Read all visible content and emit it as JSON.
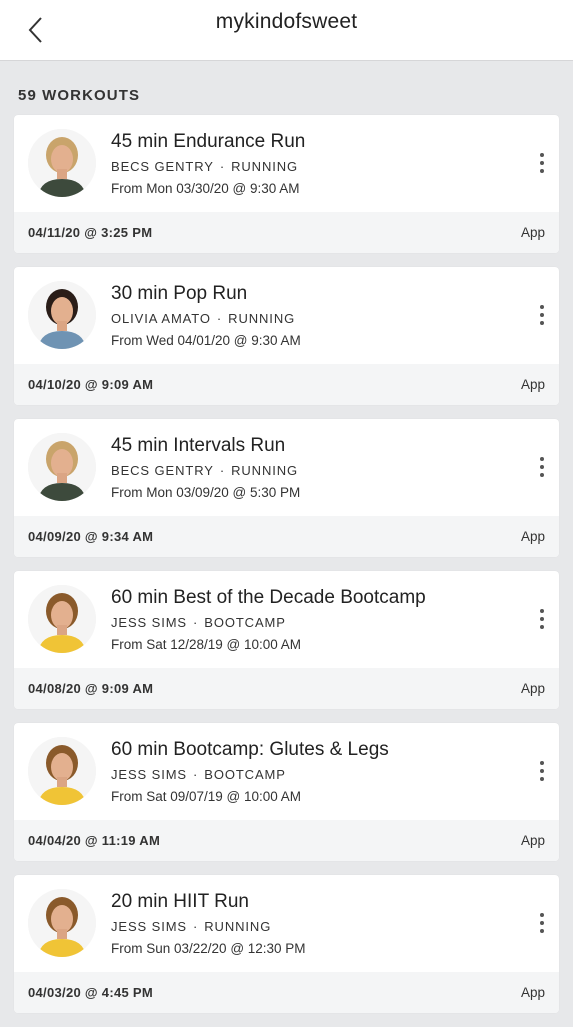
{
  "header": {
    "title": "mykindofsweet",
    "back_icon": "chevron-left-icon"
  },
  "workouts_count": "59 WORKOUTS",
  "workouts": [
    {
      "title": "45 min Endurance Run",
      "instructor": "BECS GENTRY",
      "category": "RUNNING",
      "scheduled": "From Mon 03/30/20 @ 9:30 AM",
      "completed": "04/11/20 @ 3:25 PM",
      "source": "App",
      "avatar": "instructor-becs-gentry-avatar",
      "avatar_hair": "#c9a46b",
      "avatar_top": "#3d4a3c"
    },
    {
      "title": "30 min Pop Run",
      "instructor": "OLIVIA AMATO",
      "category": "RUNNING",
      "scheduled": "From Wed 04/01/20 @ 9:30 AM",
      "completed": "04/10/20 @ 9:09 AM",
      "source": "App",
      "avatar": "instructor-olivia-amato-avatar",
      "avatar_hair": "#2a1d18",
      "avatar_top": "#6f93b3"
    },
    {
      "title": "45 min Intervals Run",
      "instructor": "BECS GENTRY",
      "category": "RUNNING",
      "scheduled": "From Mon 03/09/20 @ 5:30 PM",
      "completed": "04/09/20 @ 9:34 AM",
      "source": "App",
      "avatar": "instructor-becs-gentry-avatar",
      "avatar_hair": "#c9a46b",
      "avatar_top": "#3d4a3c"
    },
    {
      "title": "60 min Best of the Decade Bootcamp",
      "instructor": "JESS SIMS",
      "category": "BOOTCAMP",
      "scheduled": "From Sat 12/28/19 @ 10:00 AM",
      "completed": "04/08/20 @ 9:09 AM",
      "source": "App",
      "avatar": "instructor-jess-sims-avatar",
      "avatar_hair": "#8a5a2b",
      "avatar_top": "#f0c436"
    },
    {
      "title": "60 min Bootcamp: Glutes & Legs",
      "instructor": "JESS SIMS",
      "category": "BOOTCAMP",
      "scheduled": "From Sat 09/07/19 @ 10:00 AM",
      "completed": "04/04/20 @ 11:19 AM",
      "source": "App",
      "avatar": "instructor-jess-sims-avatar",
      "avatar_hair": "#8a5a2b",
      "avatar_top": "#f0c436"
    },
    {
      "title": "20 min HIIT Run",
      "instructor": "JESS SIMS",
      "category": "RUNNING",
      "scheduled": "From Sun 03/22/20 @ 12:30 PM",
      "completed": "04/03/20 @ 4:45 PM",
      "source": "App",
      "avatar": "instructor-jess-sims-avatar",
      "avatar_hair": "#8a5a2b",
      "avatar_top": "#f0c436"
    }
  ]
}
